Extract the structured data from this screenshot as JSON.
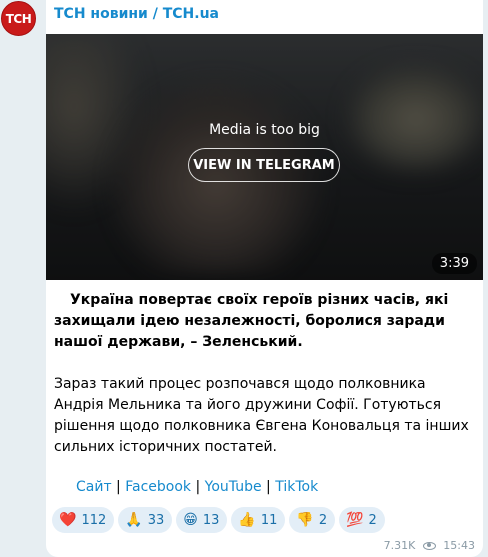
{
  "channel": {
    "avatar_text": "ТСН",
    "name": "ТСН новини / ТСН.ua",
    "brand_color": "#c91a1a",
    "name_color": "#168acd"
  },
  "media": {
    "note": "Media is too big",
    "button_label": "VIEW IN TELEGRAM",
    "duration": "3:39"
  },
  "message": {
    "paragraph1": "Україна повертає своїх героїв різних часів, які захищали ідею незалежності, боролися заради нашої держави, – Зеленський.",
    "paragraph2": "Зараз такий процес розпочався щодо полковника Андрія Мельника та його дружини Софії. Готуються рішення щодо полковника Євгена Коновальця та інших сильних історичних постатей."
  },
  "links": {
    "items": [
      "Сайт",
      "Facebook",
      "YouTube",
      "TikTok"
    ],
    "separator": " | "
  },
  "reactions": [
    {
      "emoji": "❤️",
      "icon": "red-heart-icon",
      "count": "112"
    },
    {
      "emoji": "🙏",
      "icon": "folded-hands-icon",
      "count": "33"
    },
    {
      "emoji": "😁",
      "icon": "grinning-face-icon",
      "count": "13"
    },
    {
      "emoji": "👍",
      "icon": "thumbs-up-icon",
      "count": "11"
    },
    {
      "emoji": "👎",
      "icon": "thumbs-down-icon",
      "count": "2"
    },
    {
      "emoji": "💯",
      "icon": "hundred-points-icon",
      "count": "2"
    }
  ],
  "meta": {
    "views": "7.31K",
    "time": "15:43"
  }
}
